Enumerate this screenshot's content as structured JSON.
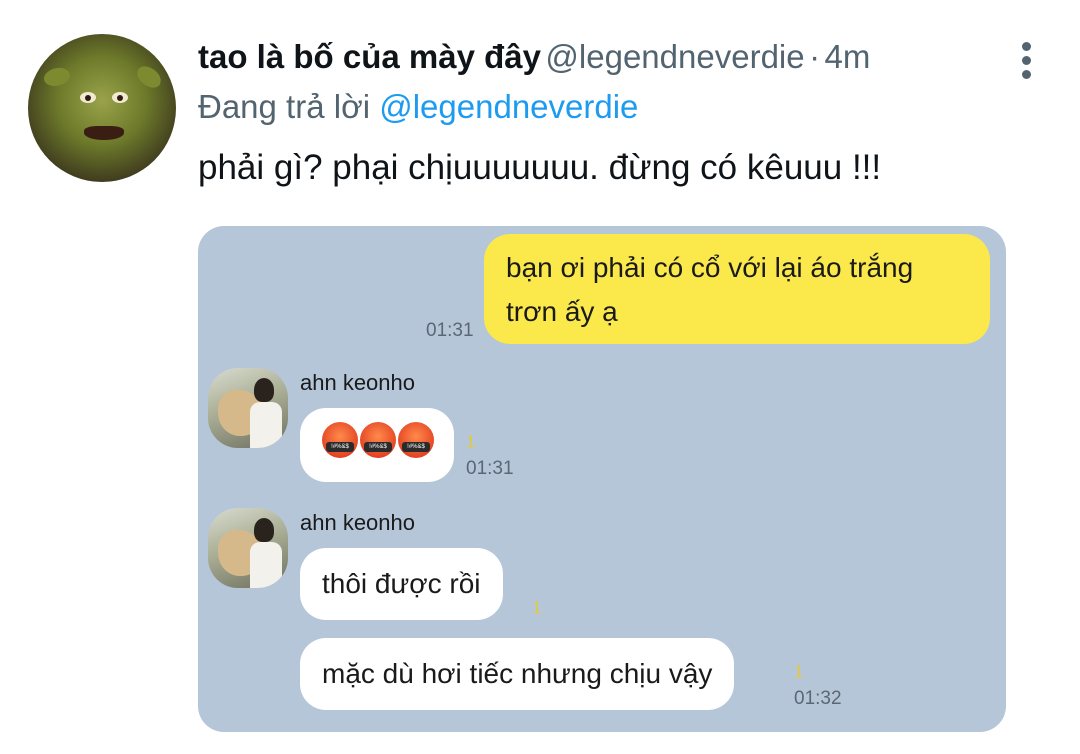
{
  "tweet": {
    "display_name": "tao là bố của mày đây",
    "handle": "@legendneverdie",
    "separator": "·",
    "time": "4m",
    "reply_prefix": "Đang trả lời",
    "reply_to": "@legendneverdie",
    "text": "phải gì? phại chịuuuuuuu. đừng có kêuuu !!!"
  },
  "icons": {
    "avatar": "shrek-avatar",
    "more": "more-vertical-icon"
  },
  "chat": {
    "messages": [
      {
        "side": "right",
        "lines": [
          "bạn ơi phải có cổ với lại áo trắng",
          "trơn ấy ạ"
        ],
        "time": "01:31"
      },
      {
        "side": "left",
        "sender": "ahn keonho",
        "content": "emoji",
        "emoji": [
          "angry-face-with-symbols",
          "angry-face-with-symbols",
          "angry-face-with-symbols"
        ],
        "unread": "1",
        "time": "01:31"
      },
      {
        "side": "left",
        "sender": "ahn keonho",
        "text": "thôi được rồi",
        "unread": "1"
      },
      {
        "side": "left",
        "text": "mặc dù hơi tiếc nhưng chịu vậy",
        "unread": "1",
        "time": "01:32"
      }
    ]
  },
  "colors": {
    "chat_background": "#b6c6d9",
    "my_bubble": "#fbe84a",
    "their_bubble": "#ffffff",
    "mention": "#1d9bf0",
    "secondary_text": "#536471"
  }
}
